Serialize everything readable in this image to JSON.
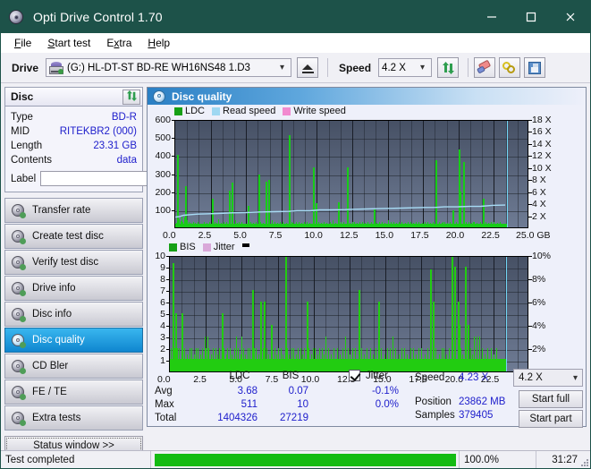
{
  "window": {
    "title": "Opti Drive Control 1.70",
    "icon": "disc-icon",
    "titlebar_color": "#1d5249",
    "buttons": {
      "minimize": "minimize-icon",
      "maximize": "maximize-icon",
      "close": "close-icon"
    }
  },
  "menubar": {
    "items": [
      {
        "label": "File",
        "accel": "F"
      },
      {
        "label": "Start test",
        "accel": "S"
      },
      {
        "label": "Extra",
        "accel": "x"
      },
      {
        "label": "Help",
        "accel": "H"
      }
    ]
  },
  "toolbar": {
    "drive_label": "Drive",
    "drive_value": "(G:)  HL-DT-ST BD-RE  WH16NS48 1.D3",
    "eject_icon": "eject-icon",
    "speed_label": "Speed",
    "speed_value": "4.2 X",
    "refresh_icon": "refresh-arrows-icon",
    "erase_icon": "eraser-icon",
    "chain_icon": "chain-links-icon",
    "save_icon": "floppy-save-icon"
  },
  "disc_panel": {
    "title": "Disc",
    "refresh_icon": "refresh-arrows-icon",
    "rows": [
      {
        "key": "Type",
        "value": "BD-R"
      },
      {
        "key": "MID",
        "value": "RITEKBR2 (000)"
      },
      {
        "key": "Length",
        "value": "23.31 GB"
      },
      {
        "key": "Contents",
        "value": "data"
      }
    ],
    "label_key": "Label",
    "label_value": "",
    "label_placeholder": "",
    "label_button_icon": "cd-disc-icon"
  },
  "nav": {
    "items": [
      {
        "label": "Transfer rate",
        "icon": "disc-icon",
        "active": false
      },
      {
        "label": "Create test disc",
        "icon": "disc-icon",
        "active": false
      },
      {
        "label": "Verify test disc",
        "icon": "disc-icon",
        "active": false
      },
      {
        "label": "Drive info",
        "icon": "disc-icon",
        "active": false
      },
      {
        "label": "Disc info",
        "icon": "disc-icon",
        "active": false
      },
      {
        "label": "Disc quality",
        "icon": "disc-icon",
        "active": true
      },
      {
        "label": "CD Bler",
        "icon": "disc-icon",
        "active": false
      },
      {
        "label": "FE / TE",
        "icon": "disc-icon",
        "active": false
      },
      {
        "label": "Extra tests",
        "icon": "disc-icon",
        "active": false
      }
    ],
    "status_button": "Status window >>"
  },
  "result": {
    "header_title": "Disc quality",
    "header_icon": "disc-icon"
  },
  "stats": {
    "col_ldc": "LDC",
    "col_bis": "BIS",
    "jitter_label": "Jitter",
    "jitter_checked": true,
    "rows": [
      {
        "name": "Avg",
        "ldc": "3.68",
        "bis": "0.07",
        "jitter": "-0.1%"
      },
      {
        "name": "Max",
        "ldc": "511",
        "bis": "10",
        "jitter": "0.0%"
      },
      {
        "name": "Total",
        "ldc": "1404326",
        "bis": "27219",
        "jitter": ""
      }
    ],
    "speed_label": "Speed",
    "speed_value": "4.23 X",
    "position_label": "Position",
    "position_value": "23862 MB",
    "samples_label": "Samples",
    "samples_value": "379405",
    "speed_select": "4.2 X",
    "start_full": "Start full",
    "start_part": "Start part"
  },
  "statusbar": {
    "message": "Test completed",
    "progress_percent": "100.0%",
    "progress_value": 100,
    "elapsed": "31:27"
  },
  "chart_data": [
    {
      "id": "ldc",
      "type": "bar",
      "title": "",
      "xlabel": "GB",
      "ylabel": "",
      "xlim": [
        0,
        25
      ],
      "ylim": [
        0,
        600
      ],
      "y2lim": [
        0,
        18
      ],
      "y2label": "X",
      "xticks": [
        0.0,
        2.5,
        5.0,
        7.5,
        10.0,
        12.5,
        15.0,
        17.5,
        20.0,
        22.5,
        25.0
      ],
      "xticklabels": [
        "0.0",
        "2.5",
        "5.0",
        "7.5",
        "10.0",
        "12.5",
        "15.0",
        "17.5",
        "20.0",
        "22.5",
        "25.0 GB"
      ],
      "yticks": [
        100,
        200,
        300,
        400,
        500,
        600
      ],
      "y2ticks": [
        2,
        4,
        6,
        8,
        10,
        12,
        14,
        16,
        18
      ],
      "y2ticklabels": [
        "2 X",
        "4 X",
        "6 X",
        "8 X",
        "10 X",
        "12 X",
        "14 X",
        "16 X",
        "18 X"
      ],
      "grid": true,
      "legend": [
        {
          "name": "LDC",
          "color": "#16a016"
        },
        {
          "name": "Read speed",
          "color": "#9fd8f2"
        },
        {
          "name": "Write speed",
          "color": "#f28ad0"
        }
      ],
      "end_marker_x": 23.4,
      "series": [
        {
          "name": "LDC",
          "type": "bar",
          "color": "#18cc18",
          "x": [
            0.05,
            0.15,
            0.25,
            0.35,
            0.42,
            0.5,
            0.6,
            0.72,
            0.85,
            0.95,
            1.1,
            1.25,
            1.4,
            1.6,
            1.8,
            2.0,
            2.2,
            2.4,
            2.6,
            2.8,
            2.9,
            3.0,
            3.2,
            3.4,
            3.6,
            3.8,
            3.95,
            4.05,
            4.2,
            4.35,
            4.5,
            4.7,
            4.9,
            5.1,
            5.3,
            5.5,
            5.7,
            5.9,
            6.0,
            6.2,
            6.4,
            6.55,
            6.65,
            6.8,
            7.0,
            7.2,
            7.4,
            7.6,
            7.8,
            8.0,
            8.2,
            8.3,
            8.5,
            8.7,
            8.9,
            9.1,
            9.3,
            9.5,
            9.7,
            9.8,
            9.9,
            10.1,
            10.3,
            10.5,
            10.7,
            10.9,
            11.1,
            11.3,
            11.5,
            11.7,
            11.9,
            12.1,
            12.3,
            12.5,
            12.6,
            12.8,
            13.0,
            13.2,
            13.4,
            13.6,
            13.8,
            14.0,
            14.2,
            14.4,
            14.6,
            14.8,
            15.0,
            15.2,
            15.4,
            15.6,
            15.8,
            16.0,
            16.2,
            16.4,
            16.6,
            16.8,
            17.0,
            17.2,
            17.4,
            17.6,
            17.8,
            18.0,
            18.2,
            18.4,
            18.6,
            18.8,
            18.9,
            19.0,
            19.2,
            19.4,
            19.6,
            19.8,
            20.0,
            20.05,
            20.15,
            20.3,
            20.5,
            20.7,
            20.9,
            21.0,
            21.1,
            21.3,
            21.5,
            21.7,
            21.9,
            22.1,
            22.3,
            22.5,
            22.7,
            22.9,
            23.1,
            23.3
          ],
          "values": [
            25,
            400,
            45,
            35,
            60,
            30,
            55,
            230,
            40,
            30,
            25,
            30,
            25,
            28,
            22,
            30,
            25,
            28,
            160,
            30,
            25,
            45,
            25,
            30,
            28,
            205,
            250,
            30,
            40,
            25,
            30,
            28,
            22,
            120,
            30,
            25,
            28,
            295,
            30,
            25,
            255,
            265,
            30,
            40,
            30,
            25,
            28,
            30,
            25,
            510,
            30,
            25,
            28,
            30,
            25,
            28,
            30,
            25,
            330,
            30,
            135,
            28,
            25,
            30,
            25,
            28,
            40,
            25,
            140,
            30,
            28,
            330,
            25,
            30,
            28,
            25,
            30,
            28,
            25,
            30,
            28,
            100,
            25,
            30,
            28,
            25,
            40,
            30,
            28,
            25,
            30,
            28,
            25,
            30,
            28,
            25,
            30,
            28,
            25,
            30,
            28,
            25,
            30,
            370,
            28,
            25,
            30,
            28,
            25,
            30,
            95,
            28,
            430,
            200,
            25,
            360,
            30,
            28,
            25,
            30,
            28,
            25,
            30,
            160,
            28,
            25,
            30,
            28,
            25,
            30
          ]
        },
        {
          "name": "Read speed",
          "type": "line",
          "color": "#a8dcf5",
          "x": [
            0.0,
            0.3,
            0.6,
            1.0,
            1.6,
            2.2,
            3.0,
            4.0,
            5.0,
            6.0,
            7.0,
            8.0,
            8.6,
            9.5,
            10.2,
            11.0,
            12.0,
            12.6,
            13.4,
            14.4,
            15.2,
            16.0,
            17.0,
            17.6,
            18.4,
            19.0,
            20.0,
            20.8,
            21.6,
            22.4,
            23.3
          ],
          "values": [
            2.0,
            2.1,
            2.3,
            2.4,
            2.5,
            2.55,
            2.6,
            2.7,
            2.75,
            2.85,
            2.9,
            2.95,
            3.05,
            3.05,
            3.2,
            3.2,
            3.25,
            3.3,
            3.35,
            3.4,
            3.45,
            3.5,
            3.55,
            3.6,
            3.62,
            3.7,
            3.72,
            3.78,
            3.8,
            3.95,
            4.0
          ]
        }
      ]
    },
    {
      "id": "bis",
      "type": "bar",
      "title": "",
      "xlabel": "GB",
      "xlim": [
        0,
        25
      ],
      "ylim": [
        0,
        10
      ],
      "y2lim": [
        0,
        10
      ],
      "y2label": "%",
      "xticks": [
        0.0,
        2.5,
        5.0,
        7.5,
        10.0,
        12.5,
        15.0,
        17.5,
        20.0,
        22.5,
        25.0
      ],
      "xticklabels": [
        "0.0",
        "2.5",
        "5.0",
        "7.5",
        "10.0",
        "12.5",
        "15.0",
        "17.5",
        "20.0",
        "22.5",
        "25.0 GB"
      ],
      "yticks": [
        1,
        2,
        3,
        4,
        5,
        6,
        7,
        8,
        9,
        10
      ],
      "y2ticks": [
        2,
        4,
        6,
        8,
        10
      ],
      "y2ticklabels": [
        "2%",
        "4%",
        "6%",
        "8%",
        "10%"
      ],
      "grid": true,
      "legend": [
        {
          "name": "BIS",
          "color": "#16a016"
        },
        {
          "name": "Jitter",
          "color": "#d9a8d9"
        }
      ],
      "end_marker_x": 23.4,
      "series": [
        {
          "name": "BIS",
          "type": "bar",
          "color": "#22cc11",
          "x": [
            0.05,
            0.2,
            0.3,
            0.4,
            0.5,
            0.65,
            0.8,
            0.9,
            1.0,
            1.2,
            1.35,
            1.5,
            1.65,
            1.8,
            1.95,
            2.1,
            2.25,
            2.4,
            2.5,
            2.6,
            2.7,
            2.85,
            3.0,
            3.15,
            3.3,
            3.45,
            3.6,
            3.75,
            3.9,
            4.0,
            4.15,
            4.3,
            4.45,
            4.6,
            4.75,
            4.9,
            5.0,
            5.1,
            5.25,
            5.4,
            5.55,
            5.7,
            5.85,
            6.0,
            6.15,
            6.3,
            6.45,
            6.55,
            6.7,
            6.85,
            7.0,
            7.1,
            7.25,
            7.4,
            7.55,
            7.7,
            7.85,
            8.0,
            8.15,
            8.3,
            8.45,
            8.6,
            8.75,
            8.9,
            9.05,
            9.2,
            9.35,
            9.5,
            9.65,
            9.8,
            9.95,
            10.1,
            10.25,
            10.4,
            10.55,
            10.7,
            10.85,
            11.0,
            11.2,
            11.4,
            11.6,
            11.8,
            12.0,
            12.2,
            12.4,
            12.5,
            12.7,
            12.9,
            13.1,
            13.3,
            13.5,
            13.7,
            13.9,
            14.1,
            14.3,
            14.5,
            14.7,
            14.9,
            15.1,
            15.3,
            15.5,
            15.7,
            15.9,
            16.1,
            16.3,
            16.5,
            16.7,
            16.9,
            17.1,
            17.3,
            17.5,
            17.7,
            17.9,
            18.1,
            18.3,
            18.5,
            18.7,
            18.9,
            19.0,
            19.2,
            19.4,
            19.6,
            19.8,
            20.0,
            20.1,
            20.2,
            20.35,
            20.5,
            20.7,
            20.9,
            21.0,
            21.15,
            21.3,
            21.5,
            21.7,
            21.9,
            22.1,
            22.3,
            22.5,
            22.7,
            22.9,
            23.1,
            23.3
          ],
          "values": [
            2,
            9.3,
            2,
            5,
            2,
            2,
            5,
            2,
            2,
            1.5,
            2,
            2,
            1.5,
            2,
            2,
            1.5,
            2,
            3,
            2,
            3,
            2,
            1.5,
            2,
            2,
            1.5,
            2,
            5,
            2,
            1.5,
            2,
            2,
            1.5,
            2,
            3,
            2,
            1.5,
            3,
            2,
            1.5,
            2,
            2,
            7,
            2,
            2,
            1.5,
            6,
            2,
            6,
            2,
            1.5,
            4,
            2,
            2,
            1.5,
            2,
            2,
            1.5,
            10,
            2,
            1.5,
            2,
            2,
            1.5,
            2,
            2,
            1.5,
            2,
            6,
            2,
            1.5,
            2,
            2,
            1.5,
            2,
            2,
            1.5,
            3,
            2,
            1.5,
            2,
            2,
            1.5,
            2,
            3,
            2,
            1.5,
            2,
            2,
            7,
            2,
            1.5,
            2,
            2,
            1.5,
            2,
            6,
            2,
            1.5,
            2,
            2,
            3,
            2,
            1.5,
            2,
            2,
            1.5,
            2,
            2,
            1.5,
            2,
            2,
            1.5,
            2,
            8.8,
            6,
            2,
            1.5,
            2,
            2,
            1.5,
            2,
            10,
            9,
            6,
            4,
            2,
            1.5,
            9,
            4,
            2,
            1.5,
            3,
            3,
            3,
            2,
            1.5,
            2,
            2,
            1.5,
            2
          ]
        }
      ]
    }
  ]
}
